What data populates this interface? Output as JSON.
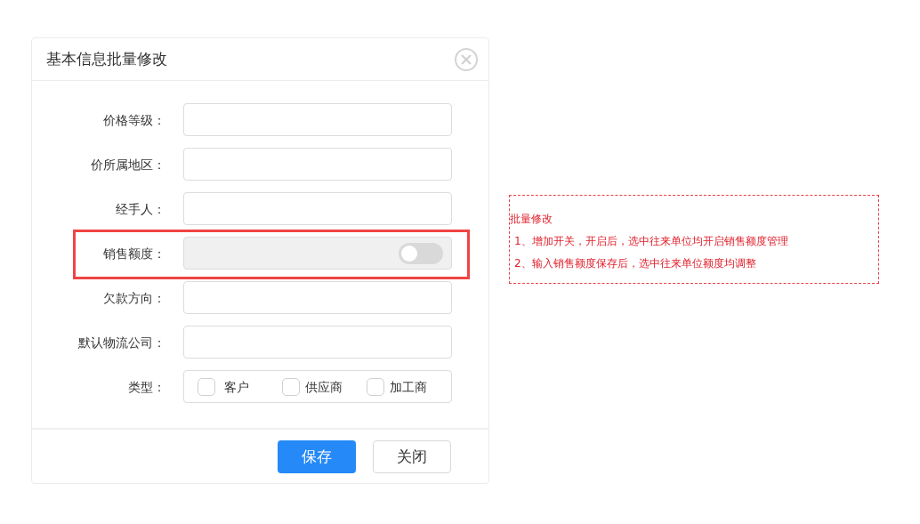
{
  "dialog": {
    "title": "基本信息批量修改",
    "fields": [
      {
        "label": "价格等级：",
        "kind": "text",
        "highlighted": false
      },
      {
        "label": "价所属地区：",
        "kind": "text",
        "highlighted": false
      },
      {
        "label": "经手人：",
        "kind": "text",
        "highlighted": false
      },
      {
        "label": "销售额度：",
        "kind": "toggle",
        "highlighted": true,
        "on": false
      },
      {
        "label": "欠款方向：",
        "kind": "text",
        "highlighted": false
      },
      {
        "label": "默认物流公司：",
        "kind": "text",
        "highlighted": false
      },
      {
        "label": "类型：",
        "kind": "checkboxes",
        "highlighted": false,
        "options": [
          {
            "label": "客户",
            "checked": false
          },
          {
            "label": "供应商",
            "checked": false
          },
          {
            "label": "加工商",
            "checked": false
          }
        ]
      }
    ],
    "buttons": [
      {
        "label": "保存",
        "kind": "primary"
      },
      {
        "label": "关闭",
        "kind": "default"
      }
    ]
  },
  "note": {
    "title": "批量修改",
    "lines": [
      "1、增加开关，开启后，选中往来单位均开启销售额度管理",
      "2、输入销售额度保存后，选中往来单位额度均调整"
    ]
  }
}
